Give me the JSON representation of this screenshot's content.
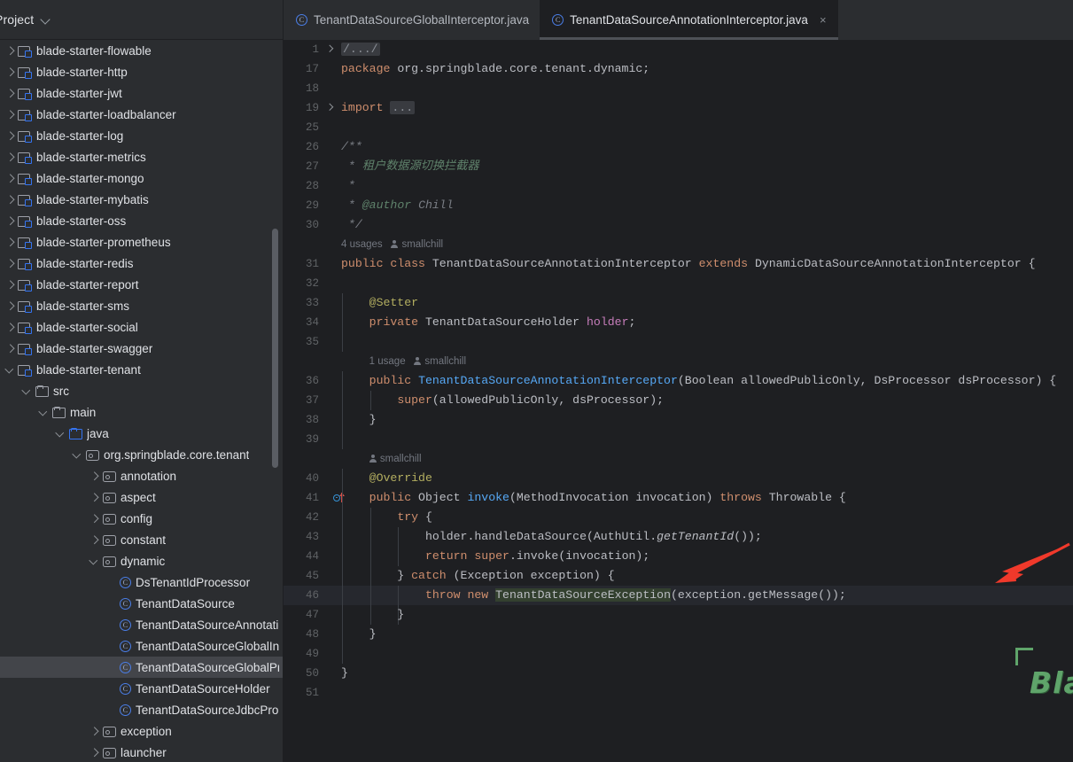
{
  "window": {
    "app": "IntelliJ IDEA",
    "background": "#1e1f22",
    "panel_background": "#2b2d30"
  },
  "sidebar": {
    "title": "Project",
    "chevron_icon": "chevron-down-icon",
    "tree": [
      {
        "label": "blade-starter-flowable",
        "indent": 1,
        "icon": "module-icon",
        "arrow": "closed",
        "selected": false
      },
      {
        "label": "blade-starter-http",
        "indent": 1,
        "icon": "module-icon",
        "arrow": "closed",
        "selected": false
      },
      {
        "label": "blade-starter-jwt",
        "indent": 1,
        "icon": "module-icon",
        "arrow": "closed",
        "selected": false
      },
      {
        "label": "blade-starter-loadbalancer",
        "indent": 1,
        "icon": "module-icon",
        "arrow": "closed",
        "selected": false
      },
      {
        "label": "blade-starter-log",
        "indent": 1,
        "icon": "module-icon",
        "arrow": "closed",
        "selected": false
      },
      {
        "label": "blade-starter-metrics",
        "indent": 1,
        "icon": "module-icon",
        "arrow": "closed",
        "selected": false
      },
      {
        "label": "blade-starter-mongo",
        "indent": 1,
        "icon": "module-icon",
        "arrow": "closed",
        "selected": false
      },
      {
        "label": "blade-starter-mybatis",
        "indent": 1,
        "icon": "module-icon",
        "arrow": "closed",
        "selected": false
      },
      {
        "label": "blade-starter-oss",
        "indent": 1,
        "icon": "module-icon",
        "arrow": "closed",
        "selected": false
      },
      {
        "label": "blade-starter-prometheus",
        "indent": 1,
        "icon": "module-icon",
        "arrow": "closed",
        "selected": false
      },
      {
        "label": "blade-starter-redis",
        "indent": 1,
        "icon": "module-icon",
        "arrow": "closed",
        "selected": false
      },
      {
        "label": "blade-starter-report",
        "indent": 1,
        "icon": "module-icon",
        "arrow": "closed",
        "selected": false
      },
      {
        "label": "blade-starter-sms",
        "indent": 1,
        "icon": "module-icon",
        "arrow": "closed",
        "selected": false
      },
      {
        "label": "blade-starter-social",
        "indent": 1,
        "icon": "module-icon",
        "arrow": "closed",
        "selected": false
      },
      {
        "label": "blade-starter-swagger",
        "indent": 1,
        "icon": "module-icon",
        "arrow": "closed",
        "selected": false
      },
      {
        "label": "blade-starter-tenant",
        "indent": 1,
        "icon": "module-icon",
        "arrow": "open",
        "selected": false
      },
      {
        "label": "src",
        "indent": 2,
        "icon": "folder-icon",
        "arrow": "open",
        "selected": false
      },
      {
        "label": "main",
        "indent": 3,
        "icon": "folder-icon",
        "arrow": "open",
        "selected": false
      },
      {
        "label": "java",
        "indent": 4,
        "icon": "source-folder-icon",
        "arrow": "open",
        "selected": false
      },
      {
        "label": "org.springblade.core.tenant",
        "indent": 5,
        "icon": "package-icon",
        "arrow": "open",
        "selected": false
      },
      {
        "label": "annotation",
        "indent": 6,
        "icon": "package-icon",
        "arrow": "closed",
        "selected": false
      },
      {
        "label": "aspect",
        "indent": 6,
        "icon": "package-icon",
        "arrow": "closed",
        "selected": false
      },
      {
        "label": "config",
        "indent": 6,
        "icon": "package-icon",
        "arrow": "closed",
        "selected": false
      },
      {
        "label": "constant",
        "indent": 6,
        "icon": "package-icon",
        "arrow": "closed",
        "selected": false
      },
      {
        "label": "dynamic",
        "indent": 6,
        "icon": "package-icon",
        "arrow": "open",
        "selected": false
      },
      {
        "label": "DsTenantIdProcessor",
        "indent": 7,
        "icon": "java-class-icon",
        "arrow": "none",
        "selected": false
      },
      {
        "label": "TenantDataSource",
        "indent": 7,
        "icon": "java-class-icon",
        "arrow": "none",
        "selected": false
      },
      {
        "label": "TenantDataSourceAnnotationInterceptor",
        "indent": 7,
        "icon": "java-class-icon",
        "arrow": "none",
        "selected": false
      },
      {
        "label": "TenantDataSourceGlobalInterceptor",
        "indent": 7,
        "icon": "java-class-icon",
        "arrow": "none",
        "selected": false
      },
      {
        "label": "TenantDataSourceGlobalProcessor",
        "indent": 7,
        "icon": "java-class-icon",
        "arrow": "none",
        "selected": true
      },
      {
        "label": "TenantDataSourceHolder",
        "indent": 7,
        "icon": "java-class-icon",
        "arrow": "none",
        "selected": false
      },
      {
        "label": "TenantDataSourceJdbcProcessor",
        "indent": 7,
        "icon": "java-class-icon",
        "arrow": "none",
        "selected": false
      },
      {
        "label": "exception",
        "indent": 6,
        "icon": "package-icon",
        "arrow": "closed",
        "selected": false
      },
      {
        "label": "launcher",
        "indent": 6,
        "icon": "package-icon",
        "arrow": "closed",
        "selected": false
      }
    ]
  },
  "tabs": [
    {
      "label": "TenantDataSourceGlobalInterceptor.java",
      "icon": "java-class-icon",
      "active": false,
      "closable": false
    },
    {
      "label": "TenantDataSourceAnnotationInterceptor.java",
      "icon": "java-class-icon",
      "active": true,
      "closable": true,
      "close_label": "×"
    }
  ],
  "editor": {
    "lines": [
      {
        "num": "1",
        "fold": true,
        "tokens": [
          {
            "t": "/.../",
            "c": "fold"
          }
        ]
      },
      {
        "num": "17",
        "tokens": [
          {
            "t": "package",
            "c": "kw"
          },
          {
            "t": " org.springblade.core.tenant.dynamic;",
            "c": "typ"
          }
        ]
      },
      {
        "num": "18",
        "tokens": []
      },
      {
        "num": "19",
        "fold": true,
        "tokens": [
          {
            "t": "import",
            "c": "kw"
          },
          {
            "t": " ",
            "c": "typ"
          },
          {
            "t": "...",
            "c": "fold"
          }
        ]
      },
      {
        "num": "25",
        "tokens": []
      },
      {
        "num": "26",
        "tokens": [
          {
            "t": "/**",
            "c": "cmt"
          }
        ]
      },
      {
        "num": "27",
        "tokens": [
          {
            "t": " * ",
            "c": "cmt"
          },
          {
            "t": "租户数据源切换拦截器",
            "c": "cmtd"
          }
        ]
      },
      {
        "num": "28",
        "tokens": [
          {
            "t": " *",
            "c": "cmt"
          }
        ]
      },
      {
        "num": "29",
        "tokens": [
          {
            "t": " * ",
            "c": "cmt"
          },
          {
            "t": "@author",
            "c": "cmtd"
          },
          {
            "t": " Chill",
            "c": "cmt"
          }
        ]
      },
      {
        "num": "30",
        "tokens": [
          {
            "t": " */",
            "c": "cmt"
          }
        ]
      },
      {
        "num": "",
        "hint": "4 usages",
        "hint_author": "smallchill"
      },
      {
        "num": "31",
        "tokens": [
          {
            "t": "public",
            "c": "kw"
          },
          {
            "t": " ",
            "c": "typ"
          },
          {
            "t": "class",
            "c": "kw"
          },
          {
            "t": " TenantDataSourceAnnotationInterceptor ",
            "c": "cls"
          },
          {
            "t": "extends",
            "c": "kw"
          },
          {
            "t": " DynamicDataSourceAnnotationInterceptor {",
            "c": "cls"
          }
        ]
      },
      {
        "num": "32",
        "tokens": []
      },
      {
        "num": "33",
        "indent": 1,
        "tokens": [
          {
            "t": "    ",
            "c": "typ"
          },
          {
            "t": "@Setter",
            "c": "ann"
          }
        ]
      },
      {
        "num": "34",
        "indent": 1,
        "tokens": [
          {
            "t": "    ",
            "c": "typ"
          },
          {
            "t": "private",
            "c": "kw"
          },
          {
            "t": " TenantDataSourceHolder ",
            "c": "typ"
          },
          {
            "t": "holder",
            "c": "fld"
          },
          {
            "t": ";",
            "c": "typ"
          }
        ]
      },
      {
        "num": "35",
        "indent": 1,
        "tokens": []
      },
      {
        "num": "",
        "indent": 1,
        "hint": "1 usage",
        "hint_author": "smallchill"
      },
      {
        "num": "36",
        "indent": 1,
        "tokens": [
          {
            "t": "    ",
            "c": "typ"
          },
          {
            "t": "public",
            "c": "kw"
          },
          {
            "t": " ",
            "c": "typ"
          },
          {
            "t": "TenantDataSourceAnnotationInterceptor",
            "c": "ctor"
          },
          {
            "t": "(Boolean allowedPublicOnly, DsProcessor dsProcessor) {",
            "c": "typ"
          }
        ]
      },
      {
        "num": "37",
        "indent": 2,
        "tokens": [
          {
            "t": "        ",
            "c": "typ"
          },
          {
            "t": "super",
            "c": "kw"
          },
          {
            "t": "(allowedPublicOnly, dsProcessor);",
            "c": "typ"
          }
        ]
      },
      {
        "num": "38",
        "indent": 1,
        "tokens": [
          {
            "t": "    }",
            "c": "typ"
          }
        ]
      },
      {
        "num": "39",
        "indent": 1,
        "tokens": []
      },
      {
        "num": "",
        "indent": 1,
        "hint": "",
        "hint_author": "smallchill"
      },
      {
        "num": "40",
        "indent": 1,
        "tokens": [
          {
            "t": "    ",
            "c": "typ"
          },
          {
            "t": "@Override",
            "c": "ann"
          }
        ]
      },
      {
        "num": "41",
        "indent": 1,
        "override_marker": true,
        "tokens": [
          {
            "t": "    ",
            "c": "typ"
          },
          {
            "t": "public",
            "c": "kw"
          },
          {
            "t": " Object ",
            "c": "typ"
          },
          {
            "t": "invoke",
            "c": "mth"
          },
          {
            "t": "(MethodInvocation invocation) ",
            "c": "typ"
          },
          {
            "t": "throws",
            "c": "kw"
          },
          {
            "t": " Throwable {",
            "c": "typ"
          }
        ]
      },
      {
        "num": "42",
        "indent": 2,
        "tokens": [
          {
            "t": "        ",
            "c": "typ"
          },
          {
            "t": "try",
            "c": "kw"
          },
          {
            "t": " {",
            "c": "typ"
          }
        ]
      },
      {
        "num": "43",
        "indent": 3,
        "tokens": [
          {
            "t": "            holder.handleDataSource(AuthUtil.",
            "c": "typ"
          },
          {
            "t": "getTenantId",
            "c": "stat"
          },
          {
            "t": "());",
            "c": "typ"
          }
        ]
      },
      {
        "num": "44",
        "indent": 3,
        "tokens": [
          {
            "t": "            ",
            "c": "typ"
          },
          {
            "t": "return",
            "c": "kw"
          },
          {
            "t": " ",
            "c": "typ"
          },
          {
            "t": "super",
            "c": "kw"
          },
          {
            "t": ".invoke(invocation);",
            "c": "typ"
          }
        ]
      },
      {
        "num": "45",
        "indent": 2,
        "tokens": [
          {
            "t": "        } ",
            "c": "typ"
          },
          {
            "t": "catch",
            "c": "kw"
          },
          {
            "t": " (Exception exception) {",
            "c": "typ"
          }
        ]
      },
      {
        "num": "46",
        "indent": 3,
        "caret": true,
        "tokens": [
          {
            "t": "            ",
            "c": "typ"
          },
          {
            "t": "throw",
            "c": "kw"
          },
          {
            "t": " ",
            "c": "typ"
          },
          {
            "t": "new",
            "c": "kw"
          },
          {
            "t": " ",
            "c": "typ"
          },
          {
            "t": "TenantDataSourceException",
            "c": "selid"
          },
          {
            "t": "(exception.getMessage());",
            "c": "typ"
          }
        ]
      },
      {
        "num": "47",
        "indent": 3,
        "tokens": [
          {
            "t": "        }",
            "c": "typ"
          }
        ]
      },
      {
        "num": "48",
        "indent": 1,
        "tokens": [
          {
            "t": "    }",
            "c": "typ"
          }
        ]
      },
      {
        "num": "49",
        "indent": 1,
        "tokens": []
      },
      {
        "num": "50",
        "tokens": [
          {
            "t": "}",
            "c": "typ"
          }
        ]
      },
      {
        "num": "51",
        "tokens": []
      }
    ]
  },
  "watermark": {
    "text": "Blade技术社区",
    "color": "#5fa46a"
  },
  "annotation": {
    "arrow_color": "#f0392b",
    "arrow_name": "red-pointer-arrow"
  }
}
